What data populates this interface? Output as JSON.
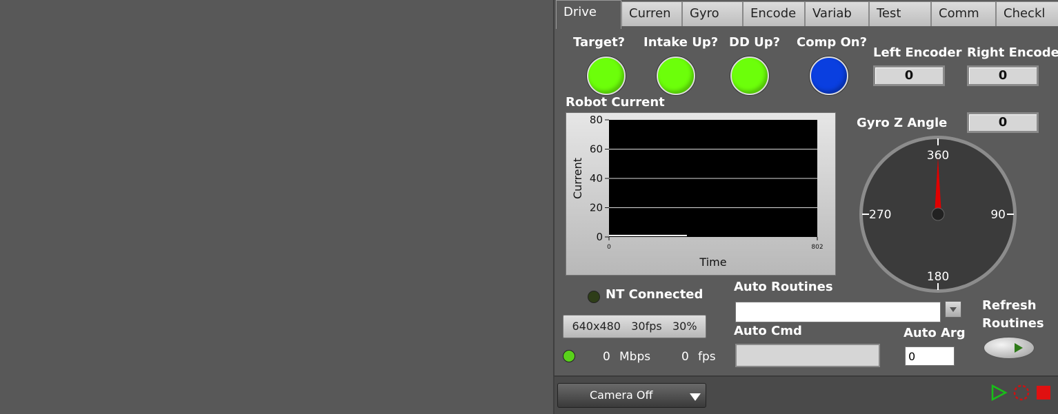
{
  "tabs": [
    "Drive",
    "Curren",
    "Gyro",
    "Encode",
    "Variab",
    "Test",
    "Comm",
    "Checkl"
  ],
  "indicators": {
    "target": {
      "label": "Target?",
      "color": "#6cff0a"
    },
    "intake": {
      "label": "Intake Up?",
      "color": "#6cff0a"
    },
    "dd": {
      "label": "DD Up?",
      "color": "#6cff0a"
    },
    "comp": {
      "label": "Comp On?",
      "color": "#0a3fe0"
    }
  },
  "encoders": {
    "left_label": "Left Encoder",
    "left_value": "0",
    "right_label": "Right Encoder",
    "right_value": "0"
  },
  "gyro": {
    "label": "Gyro Z Angle",
    "value": "0",
    "ticks": [
      "360",
      "90",
      "180",
      "270"
    ],
    "needle_angle": 0
  },
  "chart_data": {
    "type": "line",
    "title": "Robot Current",
    "xlabel": "Time",
    "ylabel": "Current",
    "xlim": [
      0,
      802
    ],
    "ylim": [
      0,
      80
    ],
    "yticks": [
      "80",
      "60",
      "40",
      "20",
      "0"
    ],
    "xticks": [
      "0",
      "802"
    ],
    "grid": true,
    "series": [
      {
        "x": [
          0,
          300
        ],
        "values": [
          1,
          1
        ]
      }
    ]
  },
  "nt": {
    "label": "NT Connected",
    "led_color": "#2e3d18"
  },
  "auto": {
    "routines_label": "Auto Routines",
    "routines_value": "",
    "cmd_label": "Auto Cmd",
    "cmd_value": "",
    "arg_label": "Auto Arg",
    "arg_value": "0"
  },
  "refresh": {
    "label_line1": "Refresh",
    "label_line2": "Routines"
  },
  "camera": {
    "resolution": "640x480",
    "fps_setting": "30fps",
    "quality": "30%",
    "mbps_value": "0",
    "mbps_unit": "Mbps",
    "fps_value": "0",
    "fps_unit": "fps",
    "status_led": "#59d21a",
    "selector": "Camera Off"
  }
}
